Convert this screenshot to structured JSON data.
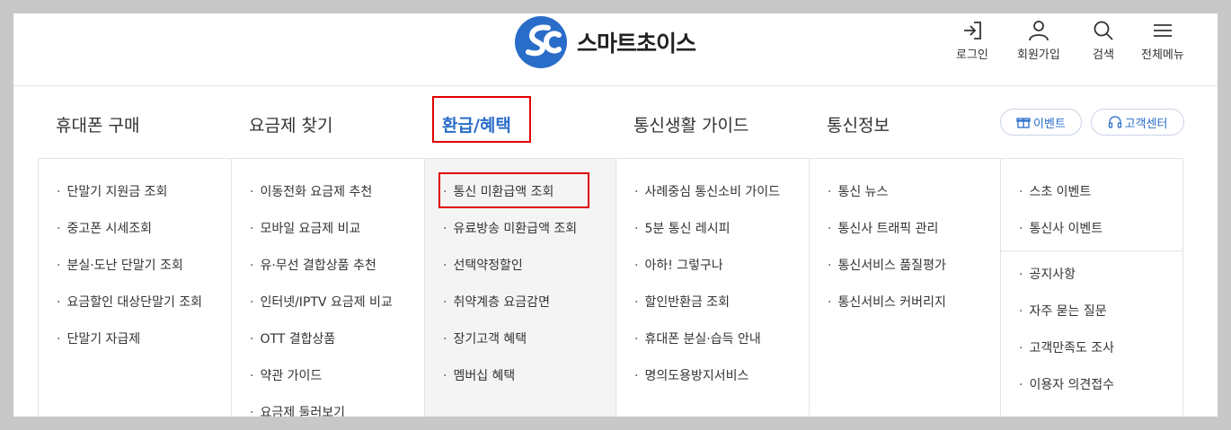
{
  "brand": {
    "name": "스마트초이스",
    "logo_color": "#2a6dc9"
  },
  "utility": [
    {
      "label": "로그인",
      "icon": "login-icon"
    },
    {
      "label": "회원가입",
      "icon": "user-icon"
    },
    {
      "label": "검색",
      "icon": "search-icon"
    },
    {
      "label": "전체메뉴",
      "icon": "menu-icon"
    }
  ],
  "nav": [
    {
      "label": "휴대폰 구매"
    },
    {
      "label": "요금제 찾기"
    },
    {
      "label": "환급/혜택",
      "active": true
    },
    {
      "label": "통신생활 가이드"
    },
    {
      "label": "통신정보"
    }
  ],
  "pills": {
    "event": "이벤트",
    "support": "고객센터"
  },
  "menus": [
    {
      "items": [
        "단말기 지원금 조회",
        "중고폰 시세조회",
        "분실·도난 단말기 조회",
        "요금할인 대상단말기 조회",
        "단말기 자급제"
      ]
    },
    {
      "items": [
        "이동전화 요금제 추천",
        "모바일 요금제 비교",
        "유·무선 결합상품 추천",
        "인터넷/IPTV 요금제 비교",
        "OTT 결합상품",
        "약관 가이드",
        "요금제 둘러보기"
      ]
    },
    {
      "items": [
        "통신 미환급액 조회",
        "유료방송 미환급액 조회",
        "선택약정할인",
        "취약계층 요금감면",
        "장기고객 혜택",
        "멤버십 혜택"
      ]
    },
    {
      "items": [
        "사례중심 통신소비 가이드",
        "5분 통신 레시피",
        "아하! 그렇구나",
        "할인반환금 조회",
        "휴대폰 분실·습득 안내",
        "명의도용방지서비스"
      ]
    },
    {
      "items": [
        "통신 뉴스",
        "통신사 트래픽 관리",
        "통신서비스 품질평가",
        "통신서비스 커버리지"
      ]
    },
    {
      "items": [
        "스초 이벤트",
        "통신사 이벤트",
        "공지사항",
        "자주 묻는 질문",
        "고객만족도 조사",
        "이용자 의견접수"
      ]
    }
  ],
  "colors": {
    "accent": "#2a6dc9",
    "highlight_box": "#e00000",
    "active_column_bg": "#f4f4f4"
  }
}
